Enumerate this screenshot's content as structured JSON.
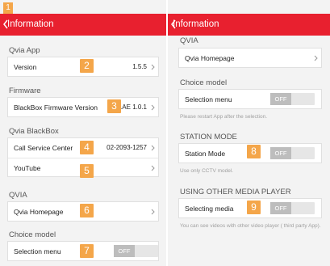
{
  "colors": {
    "accent": "#e8202f",
    "badge": "#f4a64a"
  },
  "left": {
    "title": "Information",
    "sections": {
      "qvia_app": "Qvia App",
      "firmware": "Firmware",
      "qvia_blackbox": "Qvia BlackBox",
      "qvia": "QVIA",
      "choice_model": "Choice model"
    },
    "rows": {
      "version": {
        "label": "Version",
        "value": "1.5.5"
      },
      "firmware_version": {
        "label": "BlackBox Firmware Version",
        "value": "ver.AE 1.0.1"
      },
      "call_service_center": {
        "label": "Call Service Center",
        "value": "02-2093-1257"
      },
      "youtube": {
        "label": "YouTube"
      },
      "qvia_homepage": {
        "label": "Qvia Homepage"
      },
      "selection_menu": {
        "label": "Selection menu",
        "toggle": "OFF"
      }
    }
  },
  "right": {
    "title": "Information",
    "sections": {
      "qvia": "QVIA",
      "choice_model": "Choice model",
      "station_mode": "STATION MODE",
      "other_media": "USING OTHER MEDIA PLAYER"
    },
    "rows": {
      "qvia_homepage": {
        "label": "Qvia Homepage"
      },
      "selection_menu": {
        "label": "Selection menu",
        "toggle": "OFF"
      },
      "station_mode": {
        "label": "Station Mode",
        "toggle": "OFF"
      },
      "selecting_media": {
        "label": "Selecting media",
        "toggle": "OFF"
      }
    },
    "notes": {
      "restart": "Please restart App after the selection.",
      "cctv": "Use only CCTV model.",
      "media": "You can see videos with other video player ( third party App)."
    }
  },
  "badges": [
    "1",
    "2",
    "3",
    "4",
    "5",
    "6",
    "7",
    "8",
    "9"
  ]
}
